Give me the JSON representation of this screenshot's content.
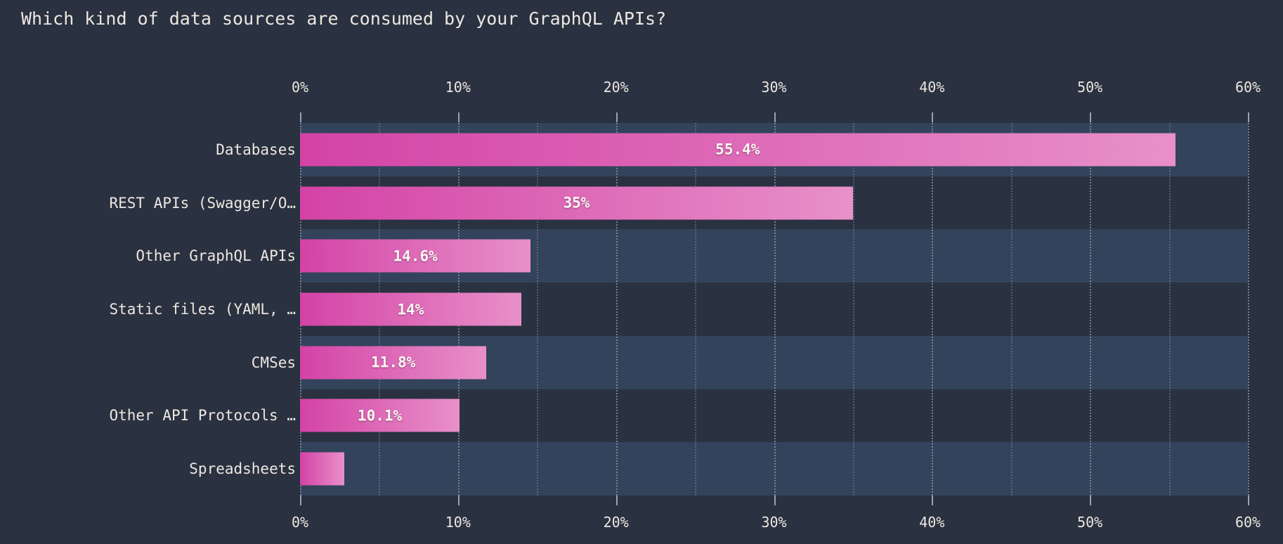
{
  "title": "Which kind of data sources are consumed by your GraphQL APIs?",
  "colors": {
    "background": "#2a3140",
    "band_alt": "#33435c",
    "bar_start": "#d343a6",
    "bar_end": "#e890c9",
    "text": "#ece8e1",
    "gridline": "#8e97a6"
  },
  "axis": {
    "tick_labels": [
      "0%",
      "10%",
      "20%",
      "30%",
      "40%",
      "50%",
      "60%"
    ],
    "tick_values": [
      0,
      10,
      20,
      30,
      40,
      50,
      60
    ],
    "minor_tick_values": [
      5,
      15,
      25,
      35,
      45,
      55
    ],
    "min": 0,
    "max": 60,
    "position": "both"
  },
  "chart_data": {
    "type": "bar",
    "orientation": "horizontal",
    "title": "Which kind of data sources are consumed by your GraphQL APIs?",
    "xlabel": "",
    "ylabel": "",
    "xlim": [
      0,
      60
    ],
    "grid": true,
    "legend": false,
    "categories": [
      "Databases",
      "REST APIs (Swagger/O…",
      "Other GraphQL APIs",
      "Static files (YAML, …",
      "CMSes",
      "Other API Protocols …",
      "Spreadsheets"
    ],
    "values": [
      55.4,
      35,
      14.6,
      14,
      11.8,
      10.1,
      2.8
    ],
    "value_labels": [
      "55.4%",
      "35%",
      "14.6%",
      "14%",
      "11.8%",
      "10.1%",
      ""
    ]
  }
}
